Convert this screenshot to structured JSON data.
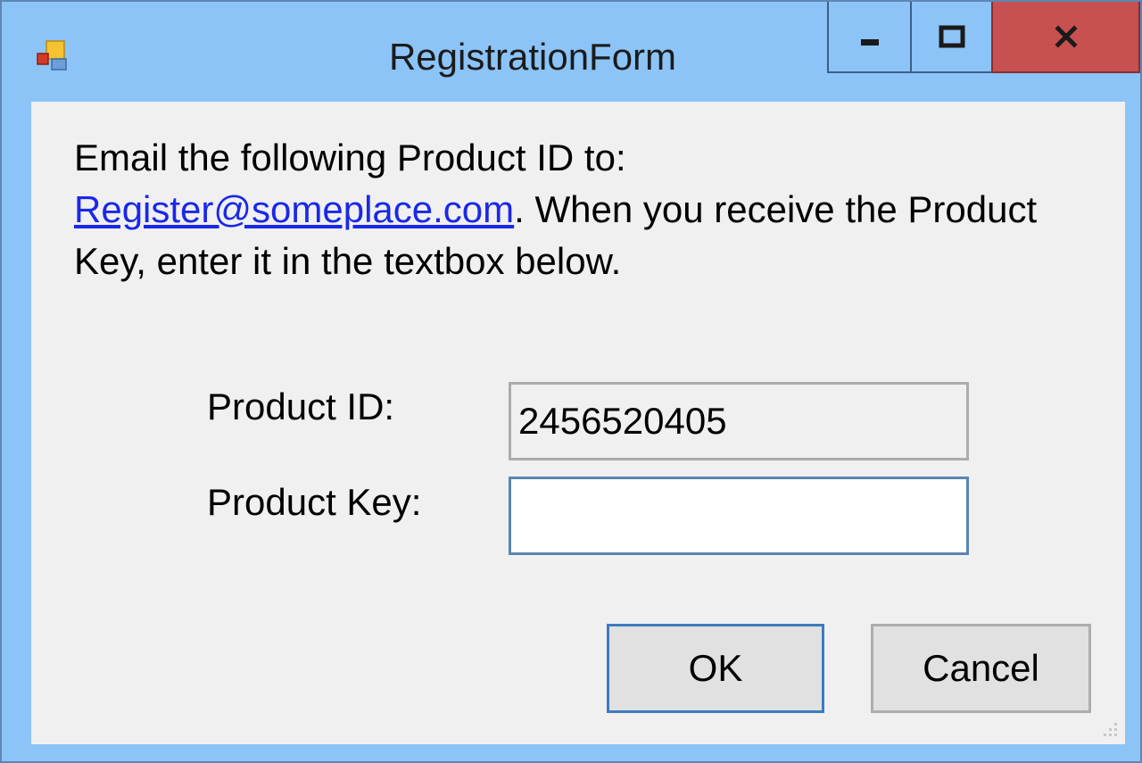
{
  "window": {
    "title": "RegistrationForm"
  },
  "caption_buttons": {
    "minimize_icon": "minimize-icon",
    "maximize_icon": "maximize-icon",
    "close_icon": "close-icon"
  },
  "instructions": {
    "prefix": "Email the following Product ID to:",
    "email_link": "Register@someplace.com",
    "suffix": ". When you receive the Product Key, enter it in the textbox below."
  },
  "form": {
    "product_id_label": "Product ID:",
    "product_id_value": "2456520405",
    "product_key_label": "Product Key:",
    "product_key_value": ""
  },
  "buttons": {
    "ok_label": "OK",
    "cancel_label": "Cancel"
  },
  "colors": {
    "titlebar": "#8cc4f8",
    "close_button": "#c75050",
    "client_background": "#f0f0f0",
    "link": "#1a28e8",
    "default_button_border": "#3d7bbf"
  }
}
